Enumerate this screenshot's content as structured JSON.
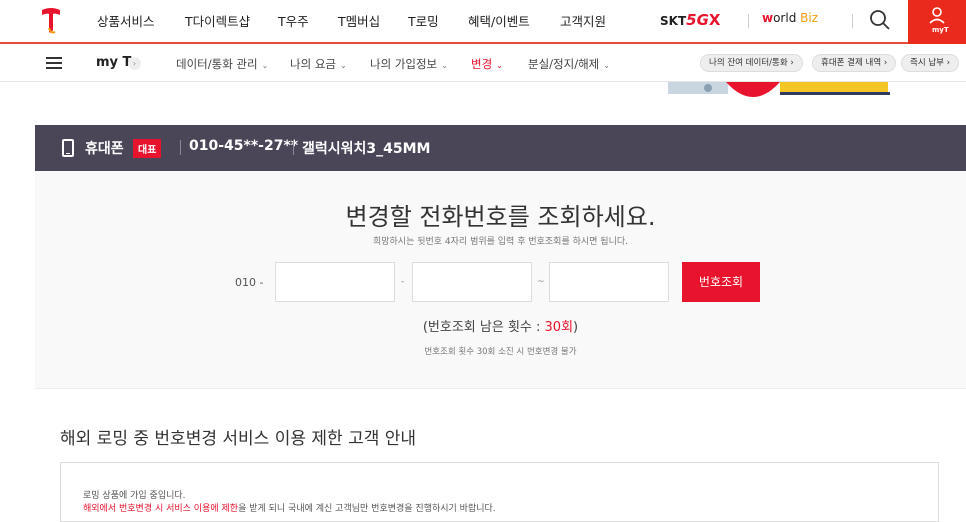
{
  "topnav": {
    "menu": [
      "상품서비스",
      "T다이렉트샵",
      "T우주",
      "T멤버십",
      "T로밍",
      "혜택/이벤트",
      "고객지원"
    ],
    "skt5gx": {
      "prefix": "SKT",
      "five": "5G",
      "x": "X"
    },
    "worldbiz": {
      "w": "w",
      "rest": "orld",
      "biz": "Biz"
    },
    "myt_label": "myT"
  },
  "subnav": {
    "myt": "my T",
    "myt_chevron": "›",
    "items": [
      {
        "label": "데이터/통화 관리",
        "chev": "⌄"
      },
      {
        "label": "나의 요금",
        "chev": "⌄"
      },
      {
        "label": "나의 가입정보",
        "chev": "⌄"
      },
      {
        "label": "변경",
        "chev": "⌄"
      },
      {
        "label": "분실/정지/해제",
        "chev": "⌄"
      }
    ],
    "pills": [
      "나의 잔여 데이터/통화 ›",
      "휴대폰 결제 내역 ›",
      "즉시 납부 ›"
    ]
  },
  "device": {
    "type": "휴대폰",
    "badge": "대표",
    "number": "010-45**-27**",
    "model": "갤럭시워치3_45MM"
  },
  "lookup": {
    "title": "변경할 전화번호를 조회하세요.",
    "description": "희망하시는 뒷번호 4자리 범위를 입력 후 번호조회를 하시면 됩니다.",
    "prefix": "010 -",
    "dash1": "-",
    "dash2": "~",
    "input1": "",
    "input2": "",
    "input3": "",
    "button": "번호조회",
    "remaining_prefix": "(번호조회 남은 횟수 : ",
    "remaining_value": "30회",
    "remaining_suffix": ")",
    "note": "번호조회 횟수 30회 소진 시 번호변경 불가"
  },
  "notice": {
    "heading": "해외 로밍 중 번호변경 서비스 이용 제한 고객 안내",
    "line1": "로밍 상품에 가입 중입니다.",
    "line2_red": "해외에서 번호변경 시 서비스 이용에 제한",
    "line2_rest": "을 받게 되니 국내에 계신 고객님만 번호변경을 진행하시기 바랍니다."
  },
  "colors": {
    "brand_red": "#e8132d",
    "device_bar": "#4a4658",
    "panel_bg": "#faf9f9"
  }
}
